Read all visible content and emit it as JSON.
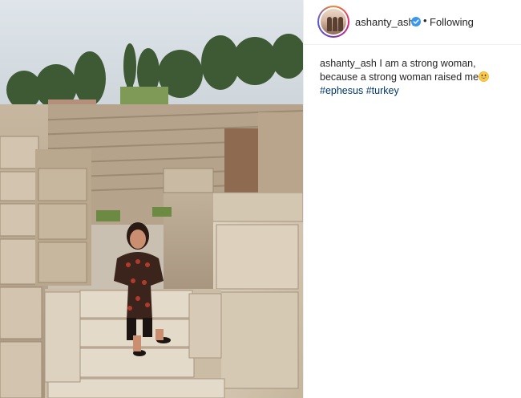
{
  "post": {
    "photo": {
      "description": ""
    },
    "header": {
      "username": "ashanty_ash",
      "dot": "•",
      "follow_status": "Following"
    },
    "caption": {
      "username": "ashanty_ash",
      "text": "I am a strong woman, because a strong woman raised me",
      "emoji": "grinning-face-with-big-eyes",
      "hashtags": [
        "#ephesus",
        "#turkey"
      ]
    },
    "colors": {
      "link": "#00376b",
      "text": "#262626",
      "verified": "#3897f0"
    }
  }
}
